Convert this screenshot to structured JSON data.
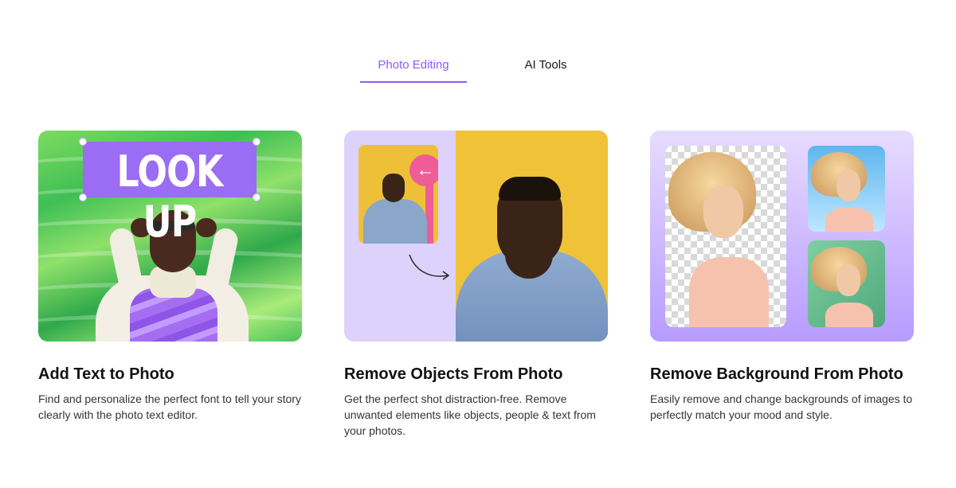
{
  "tabs": [
    {
      "label": "Photo Editing",
      "active": true
    },
    {
      "label": "AI Tools",
      "active": false
    }
  ],
  "colors": {
    "accent": "#8b5cf6",
    "text": "#111111"
  },
  "cards": [
    {
      "image_text": "LOOK UP",
      "title": "Add Text to Photo",
      "description": "Find and personalize the perfect font to tell your story clearly with the photo text editor."
    },
    {
      "title": "Remove Objects From Photo",
      "description": "Get the perfect shot distraction-free. Remove unwanted elements like objects, people & text from your photos."
    },
    {
      "title": "Remove Background From Photo",
      "description": "Easily remove and change backgrounds of images to perfectly match your mood and style."
    }
  ]
}
